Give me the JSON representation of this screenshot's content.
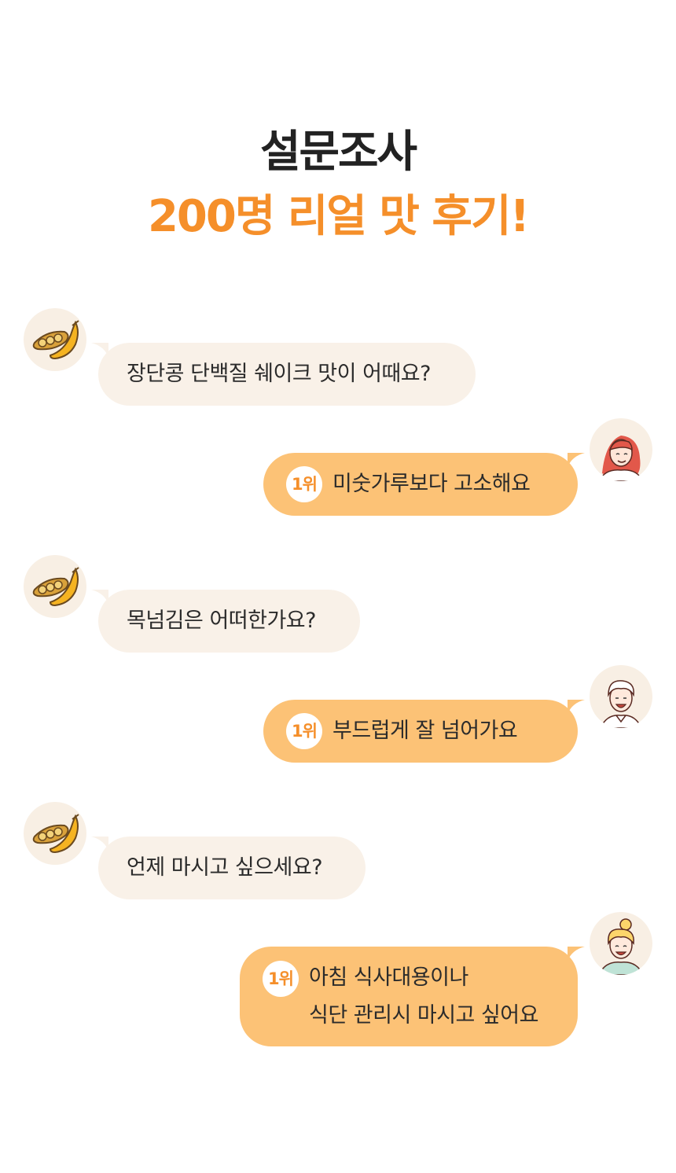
{
  "header": {
    "title": "설문조사",
    "subtitle": "200명 리얼 맛 후기!"
  },
  "colors": {
    "accent": "#f58f2a",
    "question_bubble": "#f9f1e8",
    "answer_bubble": "#fcc276"
  },
  "conversation": [
    {
      "question": "장단콩 단백질 쉐이크 맛이 어때요?",
      "rank": "1위",
      "answer_lines": [
        "미숫가루보다 고소해요"
      ]
    },
    {
      "question": "목넘김은 어떠한가요?",
      "rank": "1위",
      "answer_lines": [
        "부드럽게 잘 넘어가요"
      ]
    },
    {
      "question": "언제 마시고 싶으세요?",
      "rank": "1위",
      "answer_lines": [
        "아침 식사대용이나",
        "식단 관리시 마시고 싶어요"
      ]
    }
  ],
  "icons": {
    "asker": "soybean-pod-icon",
    "respondents": [
      "woman-red-hair-avatar",
      "man-smiling-avatar",
      "woman-bun-hair-avatar"
    ]
  }
}
